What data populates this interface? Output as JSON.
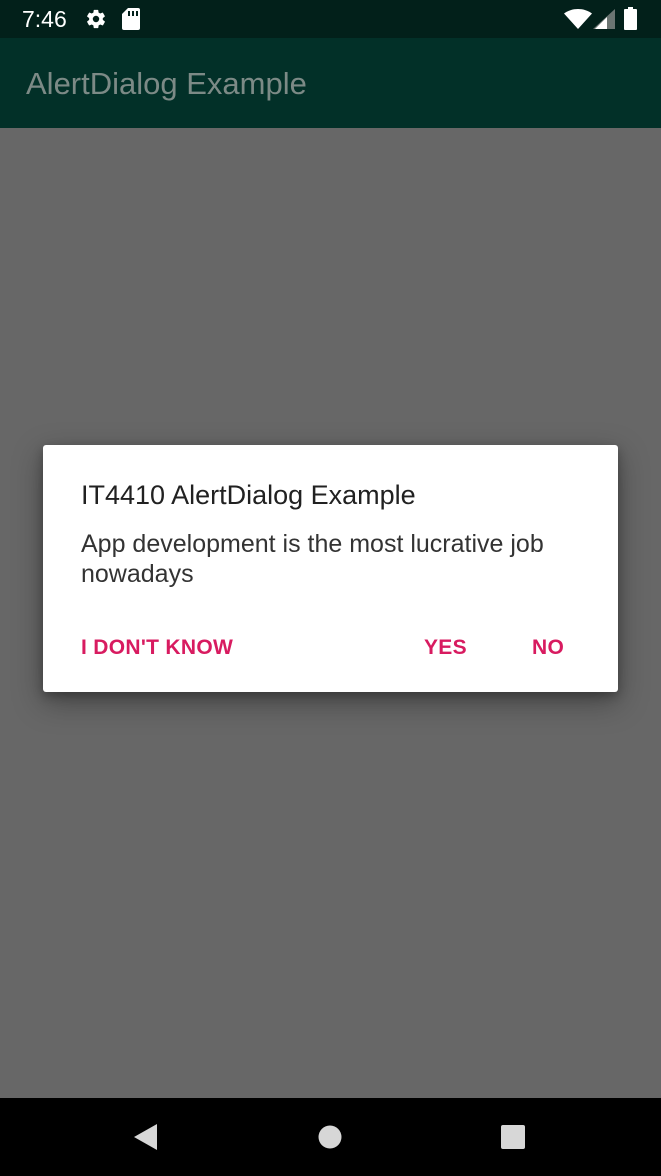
{
  "status_bar": {
    "time": "7:46",
    "icons": [
      "gear-icon",
      "sd-card-icon",
      "wifi-icon",
      "signal-icon",
      "battery-icon"
    ]
  },
  "app_bar": {
    "title": "AlertDialog Example"
  },
  "dialog": {
    "title": "IT4410 AlertDialog Example",
    "message": "App development is the most lucrative job nowadays",
    "neutral_button": "I DON'T KNOW",
    "positive_button": "YES",
    "negative_button": "NO"
  },
  "nav_bar": {
    "icons": [
      "back-icon",
      "home-icon",
      "recents-icon"
    ]
  },
  "colors": {
    "status_bar": "#02201a",
    "app_bar": "#023028",
    "scrim": "#676767",
    "accent": "#d81b60"
  }
}
